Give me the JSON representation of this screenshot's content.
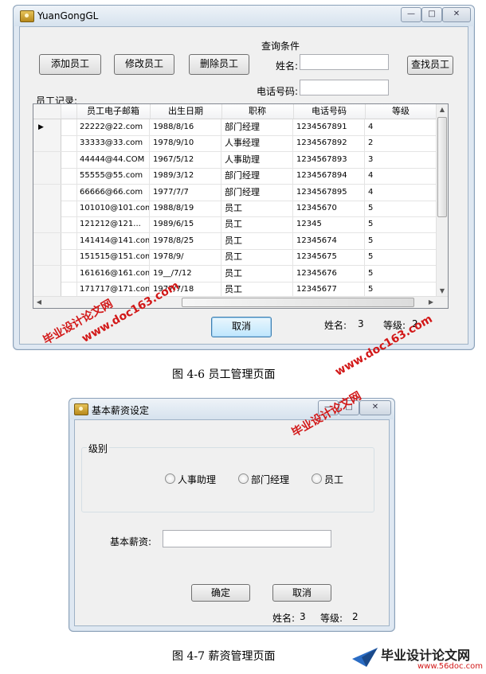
{
  "win1": {
    "title": "YuanGongGL",
    "controls": {
      "minimize": "—",
      "maximize": "□",
      "close": "✕"
    },
    "buttons": {
      "add": "添加员工",
      "edit": "修改员工",
      "delete": "删除员工",
      "find": "查找员工",
      "cancel": "取消"
    },
    "query_group": {
      "title": "查询条件",
      "name_label": "姓名:",
      "name_value": "",
      "phone_label": "电话号码:",
      "phone_value": ""
    },
    "records_label": "员工记录:",
    "table": {
      "columns": [
        "员工电子邮箱",
        "出生日期",
        "职称",
        "电话号码",
        "等级"
      ],
      "rows": [
        [
          "22222@22.com",
          "1988/8/16",
          "部门经理",
          "1234567891",
          "4"
        ],
        [
          "33333@33.com",
          "1978/9/10",
          "人事经理",
          "1234567892",
          "2"
        ],
        [
          "44444@44.COM",
          "1967/5/12",
          "人事助理",
          "1234567893",
          "3"
        ],
        [
          "55555@55.com",
          "1989/3/12",
          "部门经理",
          "1234567894",
          "4"
        ],
        [
          "66666@66.com",
          "1977/7/7",
          "部门经理",
          "1234567895",
          "4"
        ],
        [
          "101010@101.com",
          "1988/8/19",
          "员工",
          "12345670",
          "5"
        ],
        [
          "121212@121...",
          "1989/6/15",
          "员工",
          "12345",
          "5"
        ],
        [
          "141414@141.com",
          "1978/8/25",
          "员工",
          "12345674",
          "5"
        ],
        [
          "151515@151.com",
          "1978/9/",
          "员工",
          "12345675",
          "5"
        ],
        [
          "161616@161.com",
          "19__/7/12",
          "员工",
          "12345676",
          "5"
        ],
        [
          "171717@171.com",
          "1977/7/18",
          "员工",
          "12345677",
          "5"
        ]
      ]
    },
    "status": {
      "name_label": "姓名:",
      "name_value": "3",
      "level_label": "等级:",
      "level_value": "2"
    }
  },
  "caption1": "图 4-6   员工管理页面",
  "win2": {
    "title": "基本薪资设定",
    "group_title": "级别",
    "radios": [
      "人事助理",
      "部门经理",
      "员工"
    ],
    "salary_label": "基本薪资:",
    "salary_value": "",
    "buttons": {
      "ok": "确定",
      "cancel": "取消"
    },
    "status": {
      "name_label": "姓名:",
      "name_value": "3",
      "level_label": "等级:",
      "level_value": "2"
    }
  },
  "caption2": "图 4-7   薪资管理页面",
  "watermarks": {
    "site_cn": "毕业设计论文网",
    "site_url": "www.doc163.com",
    "logo_cn": "毕业设计论文网",
    "logo_url": "www.56doc.com"
  }
}
